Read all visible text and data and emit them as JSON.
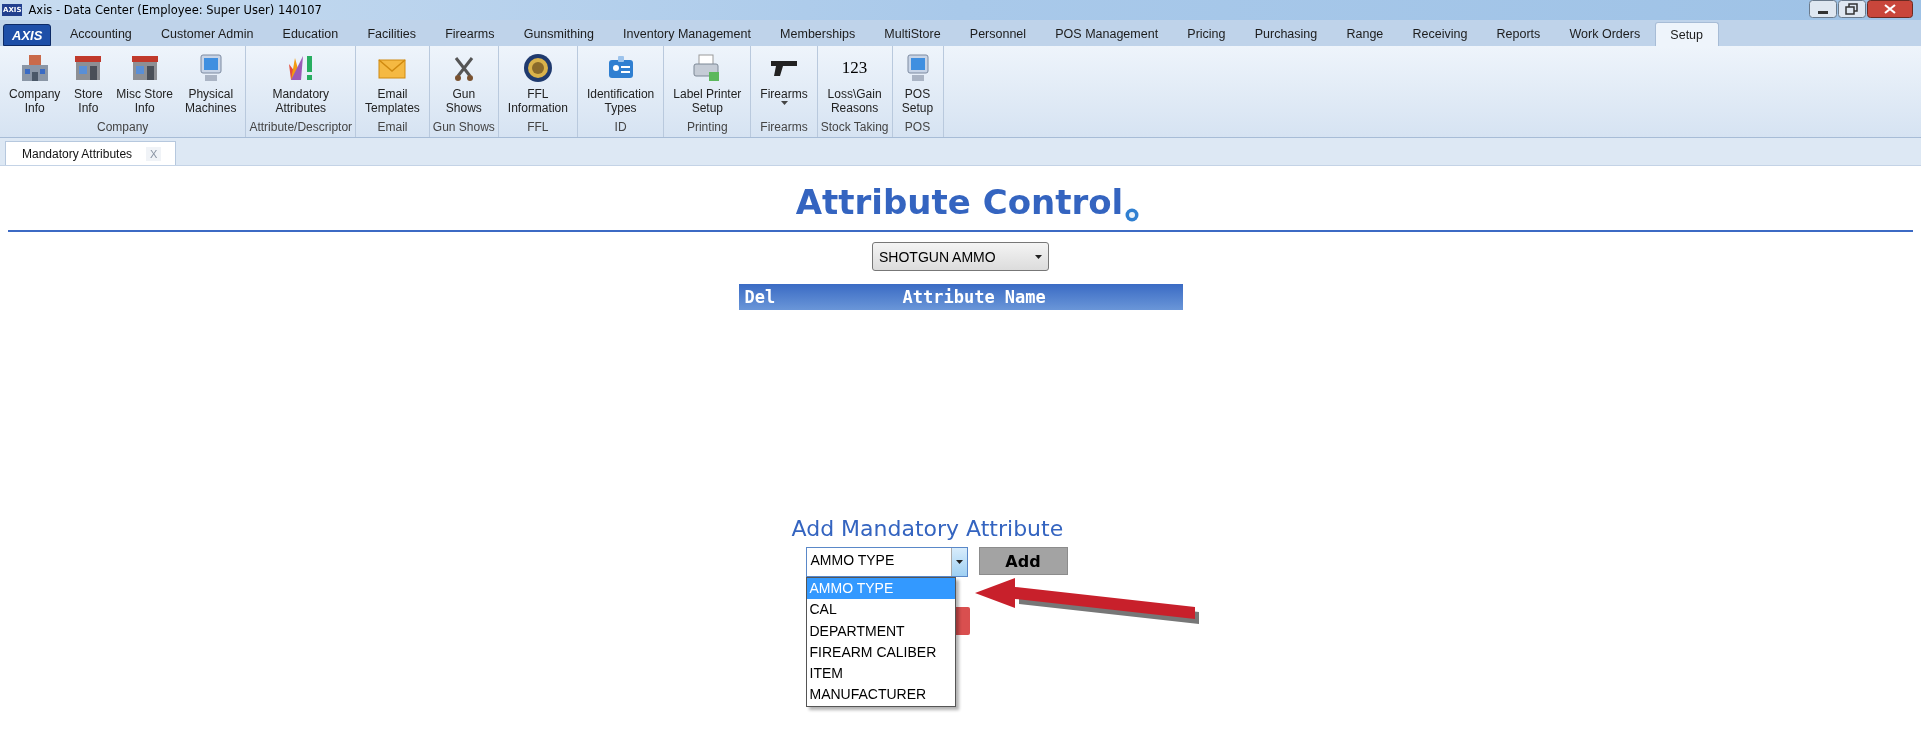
{
  "window": {
    "logo": "AXIS",
    "title": "Axis - Data Center  (Employee: Super User) 140107"
  },
  "app_button": "AXIS",
  "menu_tabs": [
    {
      "label": "Accounting",
      "selected": false
    },
    {
      "label": "Customer Admin",
      "selected": false
    },
    {
      "label": "Education",
      "selected": false
    },
    {
      "label": "Facilities",
      "selected": false
    },
    {
      "label": "Firearms",
      "selected": false
    },
    {
      "label": "Gunsmithing",
      "selected": false
    },
    {
      "label": "Inventory Management",
      "selected": false
    },
    {
      "label": "Memberships",
      "selected": false
    },
    {
      "label": "MultiStore",
      "selected": false
    },
    {
      "label": "Personnel",
      "selected": false
    },
    {
      "label": "POS Management",
      "selected": false
    },
    {
      "label": "Pricing",
      "selected": false
    },
    {
      "label": "Purchasing",
      "selected": false
    },
    {
      "label": "Range",
      "selected": false
    },
    {
      "label": "Receiving",
      "selected": false
    },
    {
      "label": "Reports",
      "selected": false
    },
    {
      "label": "Work Orders",
      "selected": false
    },
    {
      "label": "Setup",
      "selected": true
    }
  ],
  "ribbon_groups": [
    {
      "label": "Company",
      "items": [
        {
          "label": "Company\nInfo"
        },
        {
          "label": "Store\nInfo"
        },
        {
          "label": "Misc Store\nInfo"
        },
        {
          "label": "Physical\nMachines"
        }
      ]
    },
    {
      "label": "Attribute/Descriptor",
      "items": [
        {
          "label": "Mandatory\nAttributes"
        }
      ]
    },
    {
      "label": "Email",
      "items": [
        {
          "label": "Email\nTemplates"
        }
      ]
    },
    {
      "label": "Gun Shows",
      "items": [
        {
          "label": "Gun\nShows"
        }
      ]
    },
    {
      "label": "FFL",
      "items": [
        {
          "label": "FFL\nInformation"
        }
      ]
    },
    {
      "label": "ID",
      "items": [
        {
          "label": "Identification\nTypes"
        }
      ]
    },
    {
      "label": "Printing",
      "items": [
        {
          "label": "Label Printer\nSetup"
        }
      ]
    },
    {
      "label": "Firearms",
      "items": [
        {
          "label": "Firearms",
          "dropdown": true
        }
      ]
    },
    {
      "label": "Stock Taking",
      "items": [
        {
          "label": "Loss\\Gain\nReasons",
          "glyph": "123"
        }
      ]
    },
    {
      "label": "POS",
      "items": [
        {
          "label": "POS\nSetup"
        }
      ]
    }
  ],
  "doc_tabs": [
    {
      "label": "Mandatory Attributes",
      "close": "X"
    }
  ],
  "page": {
    "title": "Attribute Control",
    "category_select": "SHOTGUN AMMO",
    "table": {
      "columns": [
        "Del",
        "Attribute Name"
      ]
    },
    "add_heading": "Add Mandatory Attribute",
    "attribute_combo": {
      "value": "AMMO TYPE",
      "expanded": true,
      "options": [
        {
          "label": "AMMO TYPE",
          "selected": true
        },
        {
          "label": "CAL",
          "selected": false
        },
        {
          "label": "DEPARTMENT",
          "selected": false
        },
        {
          "label": "FIREARM CALIBER",
          "selected": false
        },
        {
          "label": "ITEM",
          "selected": false
        },
        {
          "label": "MANUFACTURER",
          "selected": false
        }
      ]
    },
    "add_button": "Add"
  }
}
